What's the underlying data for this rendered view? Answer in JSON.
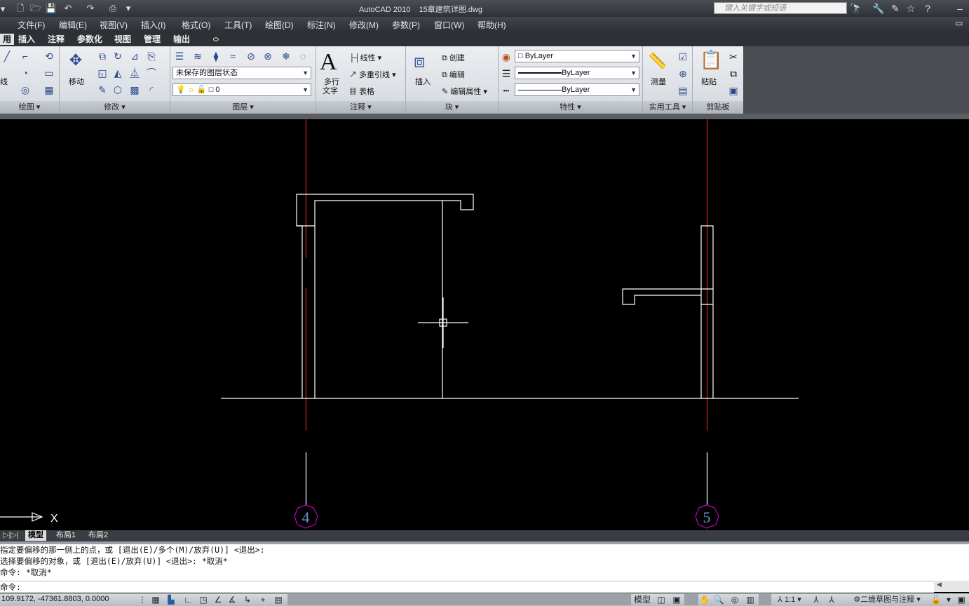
{
  "app": {
    "title": "AutoCAD 2010",
    "filename": "15章建筑详图.dwg",
    "search_placeholder": "键入关键字或短语"
  },
  "menu": [
    "文件(F)",
    "编辑(E)",
    "视图(V)",
    "插入(I)",
    "格式(O)",
    "工具(T)",
    "绘图(D)",
    "标注(N)",
    "修改(M)",
    "参数(P)",
    "窗口(W)",
    "帮助(H)"
  ],
  "ribbon_tabs": [
    {
      "label": "用",
      "active": true
    },
    {
      "label": "插入"
    },
    {
      "label": "注释"
    },
    {
      "label": "参数化"
    },
    {
      "label": "视图"
    },
    {
      "label": "管理"
    },
    {
      "label": "输出"
    }
  ],
  "ribbon": {
    "draw": {
      "title": "绘图",
      "line_label": "线"
    },
    "modify": {
      "title": "修改",
      "move_label": "移动"
    },
    "layers": {
      "title": "图层",
      "layer_state": "未保存的图层状态",
      "current_layer": "0"
    },
    "annotation": {
      "title": "注释",
      "mtext_label1": "多行",
      "mtext_label2": "文字",
      "linear": "线性",
      "mleader": "多重引线",
      "table": "表格"
    },
    "block": {
      "title": "块",
      "insert": "插入",
      "create": "创建",
      "edit": "编辑",
      "edit_attr": "编辑属性"
    },
    "properties": {
      "title": "特性",
      "color": "ByLayer",
      "linetype": "ByLayer",
      "lineweight": "ByLayer"
    },
    "utilities": {
      "title": "实用工具",
      "measure": "测量"
    },
    "clipboard": {
      "title": "剪贴板",
      "paste": "粘贴"
    }
  },
  "drawing": {
    "axis_label_x": "X",
    "grid_bubble_1": "4",
    "grid_bubble_2": "5"
  },
  "layout_tabs": [
    {
      "label": "模型",
      "active": true
    },
    {
      "label": "布局1"
    },
    {
      "label": "布局2"
    }
  ],
  "command": {
    "history": [
      "指定要偏移的那一侧上的点，或 [退出(E)/多个(M)/放弃(U)] <退出>:",
      "选择要偏移的对象，或 [退出(E)/放弃(U)] <退出>:  *取消*",
      "命令: *取消*"
    ],
    "prompt": "命令:"
  },
  "status": {
    "coords": "109.9172, -47361.8803, 0.0000",
    "model_label": "模型",
    "scale": "1:1",
    "workspace": "二维草图与注释"
  },
  "colors": {
    "canvas": "#000000",
    "axis_red": "#d42020",
    "bubble_magenta": "#c000c0",
    "geometry": "#ffffff"
  }
}
